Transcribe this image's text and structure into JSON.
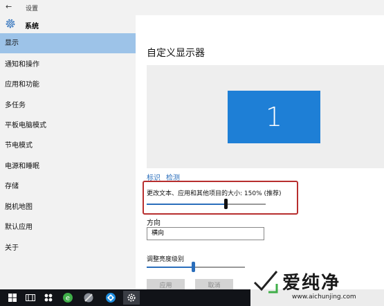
{
  "window": {
    "title": "设置",
    "back_glyph": "←"
  },
  "header": {
    "title": "系统",
    "icon": "gear-icon"
  },
  "sidebar": {
    "items": [
      {
        "label": "显示",
        "active": true
      },
      {
        "label": "通知和操作"
      },
      {
        "label": "应用和功能"
      },
      {
        "label": "多任务"
      },
      {
        "label": "平板电脑模式"
      },
      {
        "label": "节电模式"
      },
      {
        "label": "电源和睡眠"
      },
      {
        "label": "存储"
      },
      {
        "label": "脱机地图"
      },
      {
        "label": "默认应用"
      },
      {
        "label": "关于"
      }
    ]
  },
  "main": {
    "title": "自定义显示器",
    "monitor_number": "1",
    "links": {
      "identify": "标识",
      "detect": "检测"
    },
    "scale": {
      "label": "更改文本、应用和其他项目的大小: 150% (推荐)",
      "level": 0.66
    },
    "orientation": {
      "label": "方向",
      "value": "横向"
    },
    "brightness": {
      "label": "调整亮度级别",
      "level": 0.47
    },
    "buttons": {
      "apply": "应用",
      "cancel": "取消"
    }
  },
  "taskbar": {
    "icons": [
      "start-icon",
      "task-view-icon",
      "apps-icon",
      "browser-icon",
      "pinned-app-icon",
      "ie-icon",
      "settings-icon"
    ]
  },
  "watermark": {
    "text": "爱纯净",
    "url": "www.aichunjing.com"
  },
  "colors": {
    "accent": "#1e7fd6",
    "nav_active": "#9dc3e8",
    "highlight": "#b72e2e",
    "taskbar": "#111318"
  }
}
